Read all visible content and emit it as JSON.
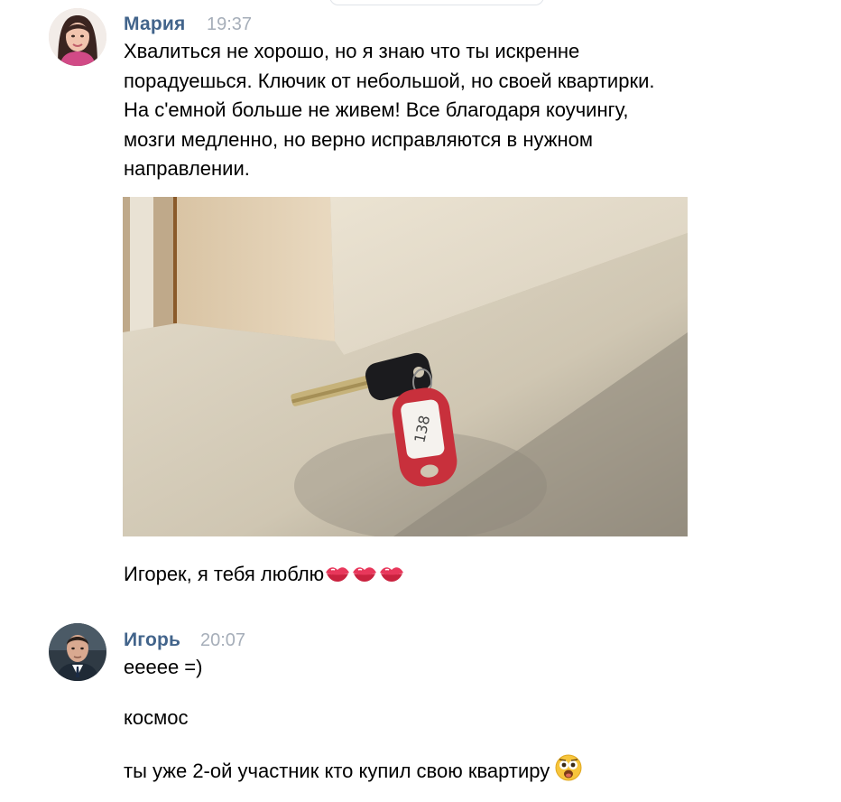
{
  "messages": [
    {
      "sender": "Мария",
      "time": "19:37",
      "avatar_icon": "user-avatar-maria",
      "lines": [
        "Хвалиться не хорошо, но я знаю что ты искренне",
        "порадуешься. Ключик от небольшой, но своей квартирки.",
        "На с'емной больше не живем! Все благодаря коучингу,",
        "мозги медленно, но верно исправляются в нужном",
        "направлении."
      ],
      "photo": {
        "icon": "key-photo",
        "tag_number": "138"
      },
      "caption": "Игорек, я тебя люблю",
      "caption_emoji": [
        "kiss-mark-icon",
        "kiss-mark-icon",
        "kiss-mark-icon"
      ]
    },
    {
      "sender": "Игорь",
      "time": "20:07",
      "avatar_icon": "user-avatar-igor",
      "texts": [
        "ееeee =)",
        "космос",
        "ты уже 2-ой участник кто купил свою квартиру"
      ],
      "last_emoji": "astonished-face-icon"
    }
  ],
  "colors": {
    "sender_name": "#42648b",
    "timestamp": "#a6aeb9",
    "text": "#000000",
    "background": "#ffffff"
  }
}
